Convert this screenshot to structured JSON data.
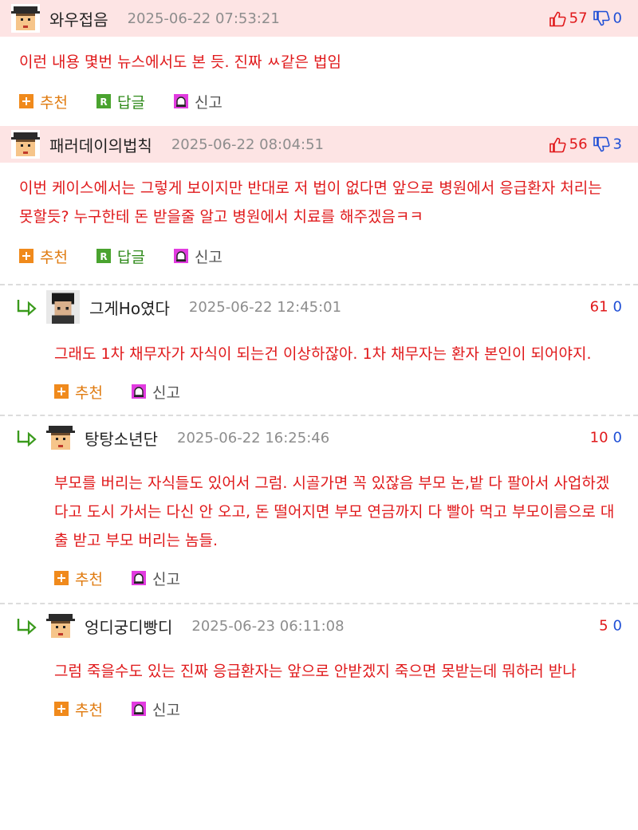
{
  "comments": [
    {
      "nick": "와우접음",
      "date": "2025-06-22 07:53:21",
      "up": "57",
      "down": "0",
      "text": "이런 내용 몇번 뉴스에서도 본 듯. 진짜 ㅆ같은 법임"
    },
    {
      "nick": "패러데이의법칙",
      "date": "2025-06-22 08:04:51",
      "up": "56",
      "down": "3",
      "text": "이번 케이스에서는 그렇게 보이지만 반대로 저 법이 없다면 앞으로 병원에서 응급환자 처리는 못할듯? 누구한테 돈 받을줄 알고 병원에서 치료를 해주겠음ㅋㅋ"
    }
  ],
  "replies": [
    {
      "nick": "그게Ho였다",
      "date": "2025-06-22 12:45:01",
      "up": "61",
      "down": "0",
      "text": "그래도 1차 채무자가 자식이 되는건 이상하잖아. 1차 채무자는 환자 본인이 되어야지."
    },
    {
      "nick": "탕탕소년단",
      "date": "2025-06-22 16:25:46",
      "up": "10",
      "down": "0",
      "text": "부모를 버리는 자식들도 있어서 그럼. 시골가면 꼭 있잖음 부모 논,밭 다 팔아서 사업하겠다고 도시 가서는 다신 안 오고, 돈 떨어지면 부모 연금까지 다 빨아 먹고 부모이름으로 대출 받고 부모 버리는 놈들."
    },
    {
      "nick": "엉디궁디빵디",
      "date": "2025-06-23 06:11:08",
      "up": "5",
      "down": "0",
      "text": "그럼 죽을수도 있는 진짜 응급환자는 앞으로 안받겠지 죽으면 못받는데 뭐하러 받나"
    }
  ],
  "actions": {
    "recommend": "추천",
    "reply": "답글",
    "report": "신고"
  },
  "colors": {
    "best_bg": "#fde4e4",
    "text_red": "#e0191b",
    "down_blue": "#1f4fd6"
  },
  "icons": {
    "avatar": "pixel-graduate-avatar",
    "avatar_photo": "person-photo-avatar",
    "up": "thumb-up-icon",
    "down": "thumb-down-icon",
    "recommend": "plus-icon",
    "reply": "reply-r-icon",
    "report": "siren-icon",
    "reply_arrow": "reply-arrow-icon"
  }
}
